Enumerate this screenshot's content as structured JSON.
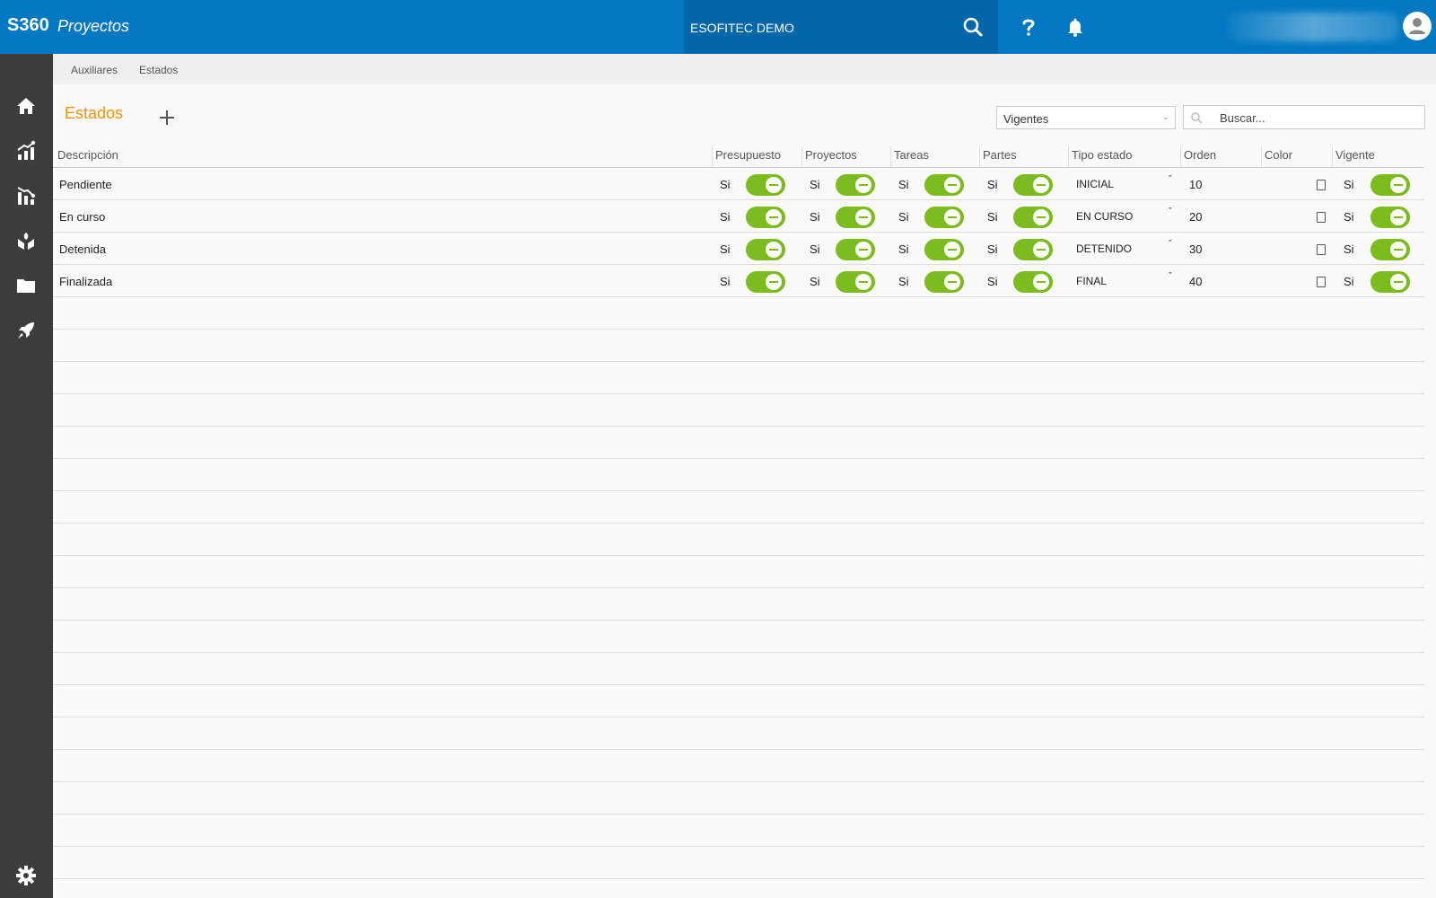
{
  "header": {
    "brand": "S360",
    "module": "Proyectos",
    "company": "ESOFITEC DEMO"
  },
  "breadcrumb": [
    "Auxiliares",
    "Estados"
  ],
  "page": {
    "title": "Estados",
    "filter_value": "Vigentes",
    "search_placeholder": "Buscar..."
  },
  "table": {
    "columns": [
      "Descripción",
      "Presupuesto",
      "Proyectos",
      "Tareas",
      "Partes",
      "Tipo estado",
      "Orden",
      "Color",
      "Vigente"
    ],
    "rows": [
      {
        "descripcion": "Pendiente",
        "presupuesto": "Si",
        "proyectos": "Si",
        "tareas": "Si",
        "partes": "Si",
        "tipo": "INICIAL",
        "orden": "10",
        "vigente": "Si"
      },
      {
        "descripcion": "En curso",
        "presupuesto": "Si",
        "proyectos": "Si",
        "tareas": "Si",
        "partes": "Si",
        "tipo": "EN CURSO",
        "orden": "20",
        "vigente": "Si"
      },
      {
        "descripcion": "Detenida",
        "presupuesto": "Si",
        "proyectos": "Si",
        "tareas": "Si",
        "partes": "Si",
        "tipo": "DETENIDO",
        "orden": "30",
        "vigente": "Si"
      },
      {
        "descripcion": "Finalizada",
        "presupuesto": "Si",
        "proyectos": "Si",
        "tareas": "Si",
        "partes": "Si",
        "tipo": "FINAL",
        "orden": "40",
        "vigente": "Si"
      }
    ]
  },
  "colors": {
    "topbar": "#0278c3",
    "sidebar": "#3d3d3d",
    "title": "#f0930c",
    "toggle_on": "#7cbc1f"
  },
  "icons": {
    "sidebar": [
      "home-icon",
      "chart-up-icon",
      "chart-down-icon",
      "hand-plant-icon",
      "folder-icon",
      "rocket-icon",
      "gear-icon"
    ],
    "header": [
      "search-icon",
      "help-icon",
      "bell-icon",
      "user-avatar-icon"
    ]
  }
}
